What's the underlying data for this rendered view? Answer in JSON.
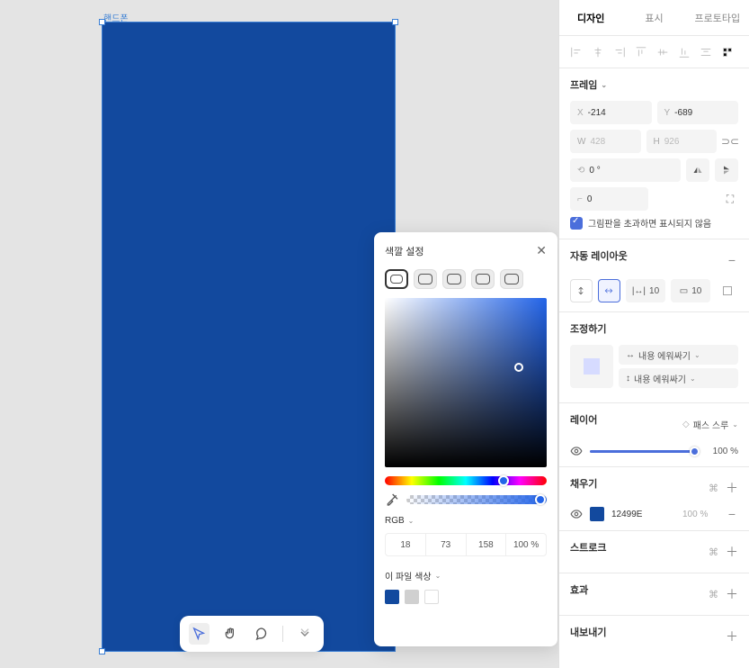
{
  "canvas": {
    "frame_label": "핸드폰"
  },
  "toolbar": {
    "tools": [
      "pointer",
      "hand",
      "comment",
      "more"
    ]
  },
  "color_panel": {
    "title": "색깔 설정",
    "format": "RGB",
    "values": {
      "r": "18",
      "g": "73",
      "b": "158",
      "a": "100 %"
    },
    "file_colors_label": "이 파일 색상"
  },
  "right_panel": {
    "tabs": {
      "design": "디자인",
      "display": "표시",
      "prototype": "프로토타입"
    },
    "frame": {
      "title": "프레임",
      "x": "-214",
      "y": "-689",
      "w": "428",
      "h": "926",
      "rotation": "0 °",
      "radius": "0",
      "clip_label": "그림판을 초과하면 표시되지 않음"
    },
    "auto_layout": {
      "title": "자동 레이아웃",
      "gap_h": "10",
      "gap_v": "10"
    },
    "adjust": {
      "title": "조정하기",
      "opt1": "내용 에워싸기",
      "opt2": "내용 에워싸기"
    },
    "layer": {
      "title": "레이어",
      "blend": "패스 스루",
      "opacity": "100  %"
    },
    "fill": {
      "title": "채우기",
      "hex": "12499E",
      "opacity": "100  %"
    },
    "stroke": {
      "title": "스트로크"
    },
    "effect": {
      "title": "효과"
    },
    "export": {
      "title": "내보내기"
    }
  }
}
